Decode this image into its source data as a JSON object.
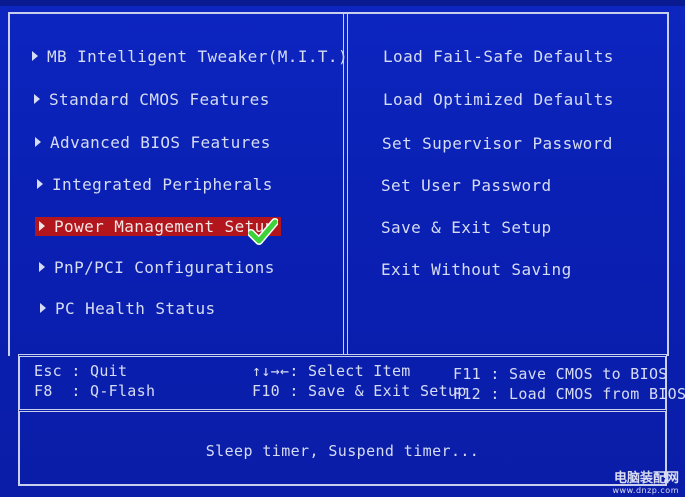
{
  "menu_left": [
    {
      "label": "MB Intelligent Tweaker(M.I.T.)",
      "selected": false
    },
    {
      "label": "Standard CMOS Features",
      "selected": false
    },
    {
      "label": "Advanced BIOS Features",
      "selected": false
    },
    {
      "label": "Integrated Peripherals",
      "selected": false
    },
    {
      "label": "Power Management Setup",
      "selected": true
    },
    {
      "label": "PnP/PCI Configurations",
      "selected": false
    },
    {
      "label": "PC Health Status",
      "selected": false
    }
  ],
  "menu_right": [
    "Load Fail-Safe Defaults",
    "Load Optimized Defaults",
    "Set Supervisor Password",
    "Set User Password",
    "Save & Exit Setup",
    "Exit Without Saving"
  ],
  "keys": {
    "esc": "Esc : Quit",
    "f8": "F8  : Q-Flash",
    "arrows": "↑↓→←: Select Item",
    "f10": "F10 : Save & Exit Setup",
    "f11": "F11 : Save CMOS to BIOS",
    "f12": "F12 : Load CMOS from BIOS"
  },
  "status": "Sleep timer, Suspend timer...",
  "watermark": {
    "site_cn": "电脑装配网",
    "url": "www.dnzp.com"
  },
  "colors": {
    "background": "#0a20b4",
    "highlight": "#b3151c",
    "checkmark": "#3ed23a"
  }
}
